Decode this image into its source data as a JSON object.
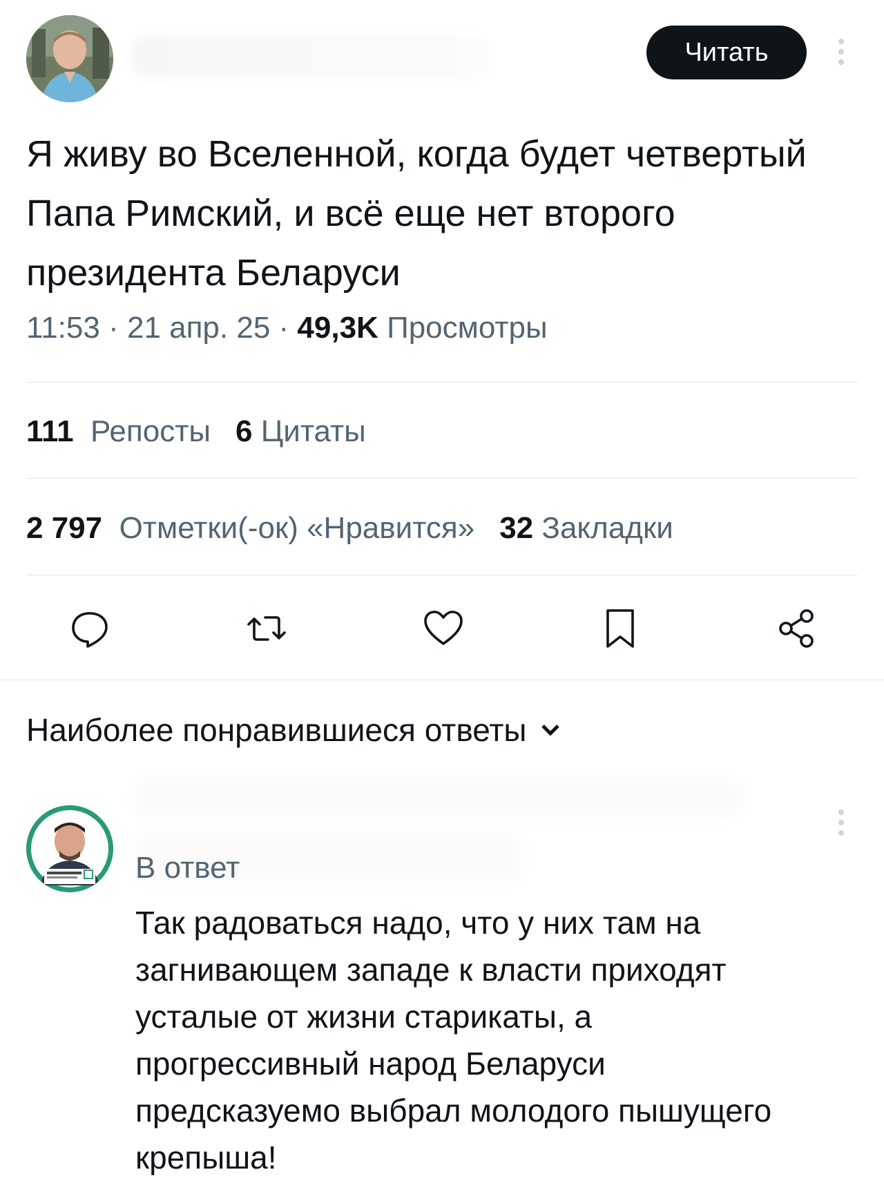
{
  "header": {
    "follow_button": "Читать"
  },
  "tweet": {
    "text": "Я живу во Вселенной, когда будет четвертый Папа Римский, и всё еще нет второго президента Беларуси",
    "time": "11:53",
    "separator": "·",
    "date": "21 апр. 25",
    "views_count": "49,3K",
    "views_label": "Просмотры"
  },
  "stats": {
    "reposts_count": "111",
    "reposts_label": "Репосты",
    "quotes_count": "6",
    "quotes_label": "Цитаты",
    "likes_count": "2 797",
    "likes_label": "Отметки(-ок) «Нравится»",
    "bookmarks_count": "32",
    "bookmarks_label": "Закладки"
  },
  "replies": {
    "heading": "Наиболее понравившиеся ответы",
    "reply": {
      "context_label": "В ответ",
      "text": "Так радоваться надо, что у них там на\nзагнивающем западе  к власти приходят\nусталые от жизни старикаты, а\nпрогрессивный народ Беларуси\nпредсказуемо выбрал молодого пышущего\nкрепыша!"
    }
  },
  "icons": {
    "reply": "reply-icon",
    "repost": "repost-icon",
    "like": "heart-icon",
    "bookmark": "bookmark-icon",
    "share": "share-icon",
    "more": "more-vertical-icon",
    "chevron": "chevron-down-icon"
  }
}
